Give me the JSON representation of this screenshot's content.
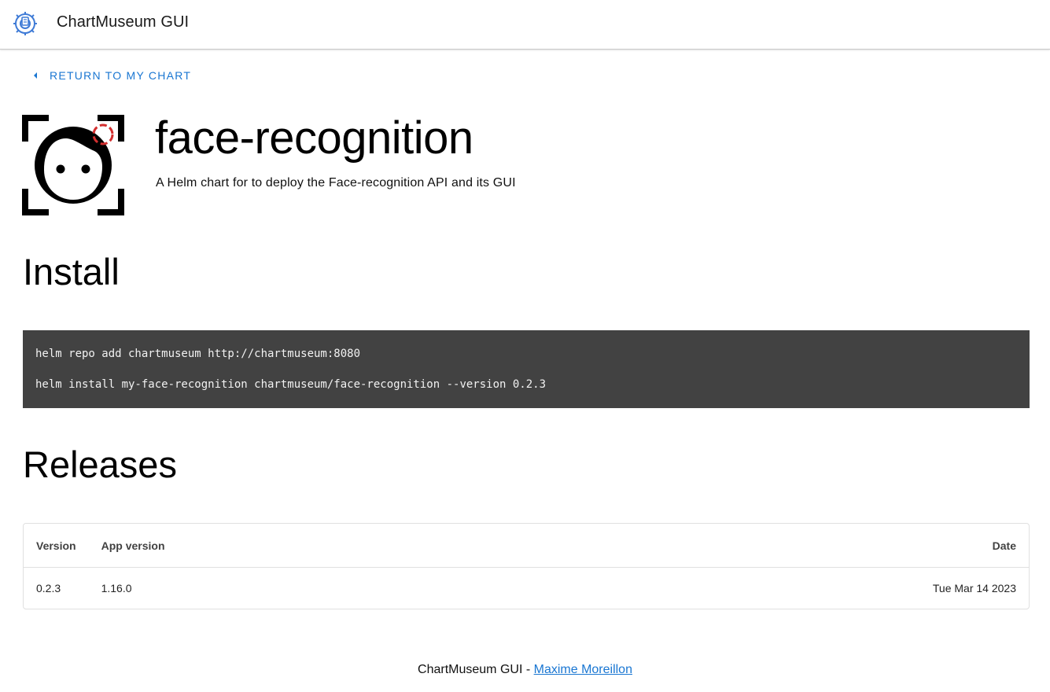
{
  "app": {
    "title": "ChartMuseum GUI",
    "logo_icon": "chartmuseum-logo-icon"
  },
  "nav": {
    "back_label": "RETURN TO MY CHART",
    "back_icon": "chevron-left-icon"
  },
  "chart": {
    "name": "face-recognition",
    "description": "A Helm chart for to deploy the Face-recognition API and its GUI",
    "icon": "face-recognition-icon"
  },
  "install": {
    "title": "Install",
    "commands": [
      "helm repo add chartmuseum http://chartmuseum:8080",
      "helm install my-face-recognition chartmuseum/face-recognition --version 0.2.3"
    ]
  },
  "releases": {
    "title": "Releases",
    "headers": {
      "version": "Version",
      "app_version": "App version",
      "date": "Date"
    },
    "rows": [
      {
        "version": "0.2.3",
        "app_version": "1.16.0",
        "date": "Tue Mar 14 2023"
      }
    ]
  },
  "footer": {
    "text": "ChartMuseum GUI - ",
    "author": "Maxime Moreillon"
  },
  "colors": {
    "accent": "#1976d2",
    "code_bg": "#424242",
    "logo_blue": "#3f7bd6",
    "face_accent_red": "#d32f2f"
  }
}
